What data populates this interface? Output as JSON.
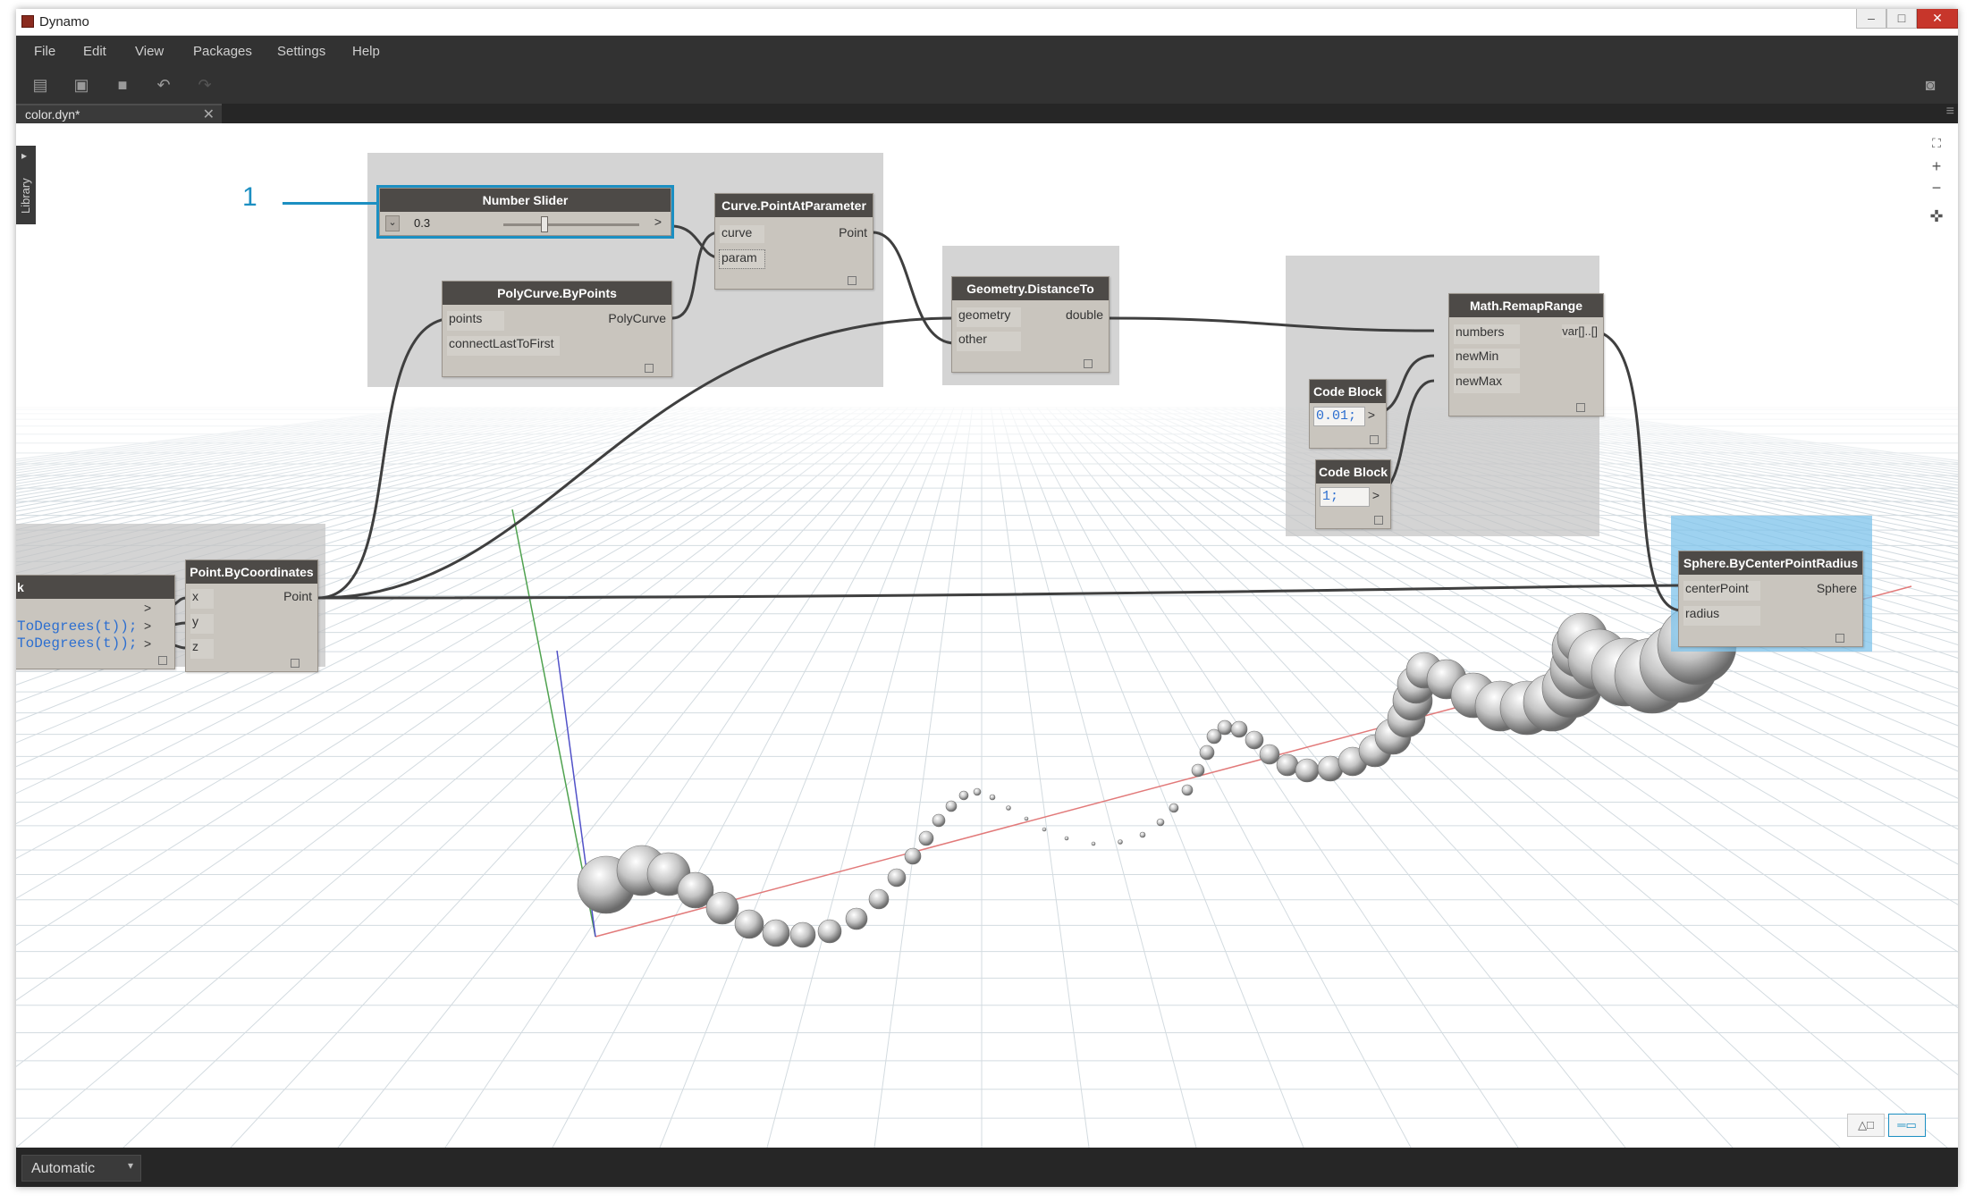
{
  "window": {
    "title": "Dynamo",
    "min": "–",
    "max": "□",
    "close": "✕"
  },
  "menu": [
    "File",
    "Edit",
    "View",
    "Packages",
    "Settings",
    "Help"
  ],
  "toolbar": {
    "new_icon": "▤",
    "open_icon": "▣",
    "save_icon": "■",
    "undo_icon": "↶",
    "redo_icon": "↷",
    "camera_icon": "◙"
  },
  "tab": {
    "label": "color.dyn*",
    "close": "✕",
    "menu_icon": "≡"
  },
  "library": {
    "label": "Library",
    "arrow": "▸"
  },
  "nav": {
    "fit_icon": "⛶",
    "zoom_in": "+",
    "zoom_out": "−",
    "pan_icon": "✜"
  },
  "callout": {
    "number": "1"
  },
  "nodes": {
    "number_slider": {
      "title": "Number Slider",
      "value": "0.3",
      "level": 0.3,
      "caret": "⌄",
      "right": ">"
    },
    "curve_point": {
      "title": "Curve.PointAtParameter",
      "in": [
        "curve",
        "param"
      ],
      "out": "Point"
    },
    "polycurve": {
      "title": "PolyCurve.ByPoints",
      "in": [
        "points",
        "connectLastToFirst"
      ],
      "out": "PolyCurve"
    },
    "distance": {
      "title": "Geometry.DistanceTo",
      "in": [
        "geometry",
        "other"
      ],
      "out": "double"
    },
    "remap": {
      "title": "Math.RemapRange",
      "in": [
        "numbers",
        "newMin",
        "newMax"
      ],
      "out": "var[]..[]"
    },
    "code1": {
      "title": "Code Block",
      "code": "0.01;",
      "out": ">"
    },
    "code2": {
      "title": "Code Block",
      "code": "1;",
      "out": ">"
    },
    "point_coords": {
      "title": "Point.ByCoordinates",
      "in": [
        "x",
        "y",
        "z"
      ],
      "out": "Point"
    },
    "code_left": {
      "title": "k",
      "lines": [
        "ToDegrees(t));",
        "ToDegrees(t));"
      ],
      "out": [
        ">",
        ">",
        ">"
      ]
    },
    "sphere": {
      "title": "Sphere.ByCenterPointRadius",
      "in": [
        "centerPoint",
        "radius"
      ],
      "out": "Sphere"
    }
  },
  "view_toggles": {
    "geometry_icon": "△□",
    "graph_icon": "═▭"
  },
  "status": {
    "run_mode": "Automatic",
    "caret": "▾"
  },
  "colors": {
    "accent": "#1c8fc2",
    "header": "#4d4a47",
    "node_body": "#c9c5be",
    "menubar": "#323232"
  }
}
